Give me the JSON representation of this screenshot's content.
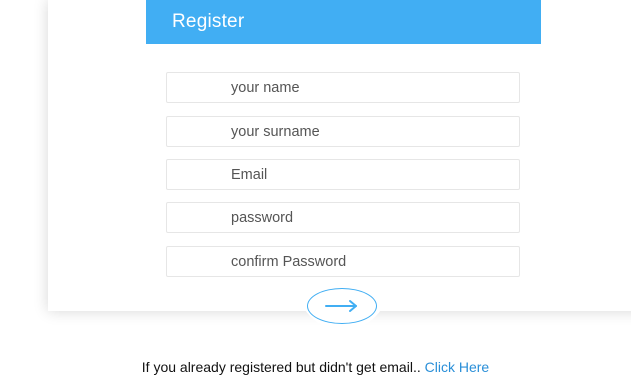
{
  "form": {
    "title": "Register",
    "fields": [
      {
        "name": "name",
        "placeholder": "your name",
        "value": ""
      },
      {
        "name": "surname",
        "placeholder": "your surname",
        "value": ""
      },
      {
        "name": "email",
        "placeholder": "Email",
        "value": ""
      },
      {
        "name": "password",
        "placeholder": "password",
        "value": ""
      },
      {
        "name": "confirm_password",
        "placeholder": "confirm Password",
        "value": ""
      }
    ],
    "submit_icon": "arrow-right-icon"
  },
  "footer": {
    "text": "If you already registered but didn't get email.. ",
    "link_label": "Click Here"
  },
  "colors": {
    "accent": "#41aef3",
    "link": "#2a8fd8",
    "placeholder": "#555555",
    "field_border": "#e6e6e6"
  }
}
